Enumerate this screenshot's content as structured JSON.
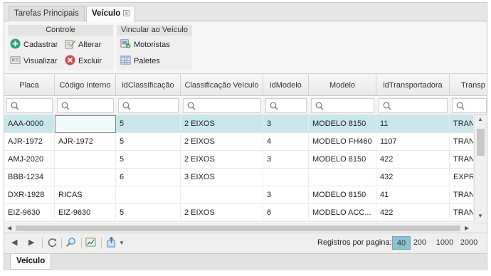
{
  "tabs": [
    {
      "label": "Tarefas Principais"
    },
    {
      "label": "Veículo",
      "close": "x"
    }
  ],
  "ribbon": {
    "controle": {
      "title": "Controle",
      "cadastrar": "Cadastrar",
      "alterar": "Alterar",
      "visualizar": "Visualizar",
      "excluir": "Excluir"
    },
    "vincular": {
      "title": "Vincular ao Veículo",
      "motoristas": "Motoristas",
      "paletes": "Paletes"
    }
  },
  "grid": {
    "columns": [
      "Placa",
      "Código Interno",
      "idClassificação",
      "Classificação Veículo",
      "idModelo",
      "Modelo",
      "idTransportadora",
      "Transp"
    ],
    "rows": [
      [
        "AAA-0000",
        "",
        "5",
        "2 EIXOS",
        "3",
        "MODELO 8150",
        "11",
        "TRAN"
      ],
      [
        "AJR-1972",
        "AJR-1972",
        "5",
        "2 EIXOS",
        "4",
        "MODELO FH460",
        "1107",
        "TRAN"
      ],
      [
        "AMJ-2020",
        "",
        "5",
        "2 EIXOS",
        "3",
        "MODELO 8150",
        "422",
        "TRAN"
      ],
      [
        "BBB-1234",
        "",
        "6",
        "3 EIXOS",
        "",
        "",
        "432",
        "EXPR"
      ],
      [
        "DXR-1928",
        "RICAS",
        "",
        "",
        "3",
        "MODELO 8150",
        "41",
        "TRAN"
      ],
      [
        "EIZ-9630",
        "EIZ-9630",
        "5",
        "2 EIXOS",
        "6",
        "MODELO ACC...",
        "422",
        "TRAN"
      ]
    ],
    "selected_row": 0
  },
  "pager": {
    "label": "Registros por pagina:",
    "sizes": [
      "40",
      "200",
      "1000",
      "2000"
    ],
    "active_size": "40"
  },
  "bottom_tab": {
    "label": "Veículo"
  },
  "colors": {
    "selected_row": "#c9e6ea",
    "active_page_size": "#8cc3d0",
    "add_icon": "#2aa572",
    "delete_icon": "#d64a4a"
  }
}
